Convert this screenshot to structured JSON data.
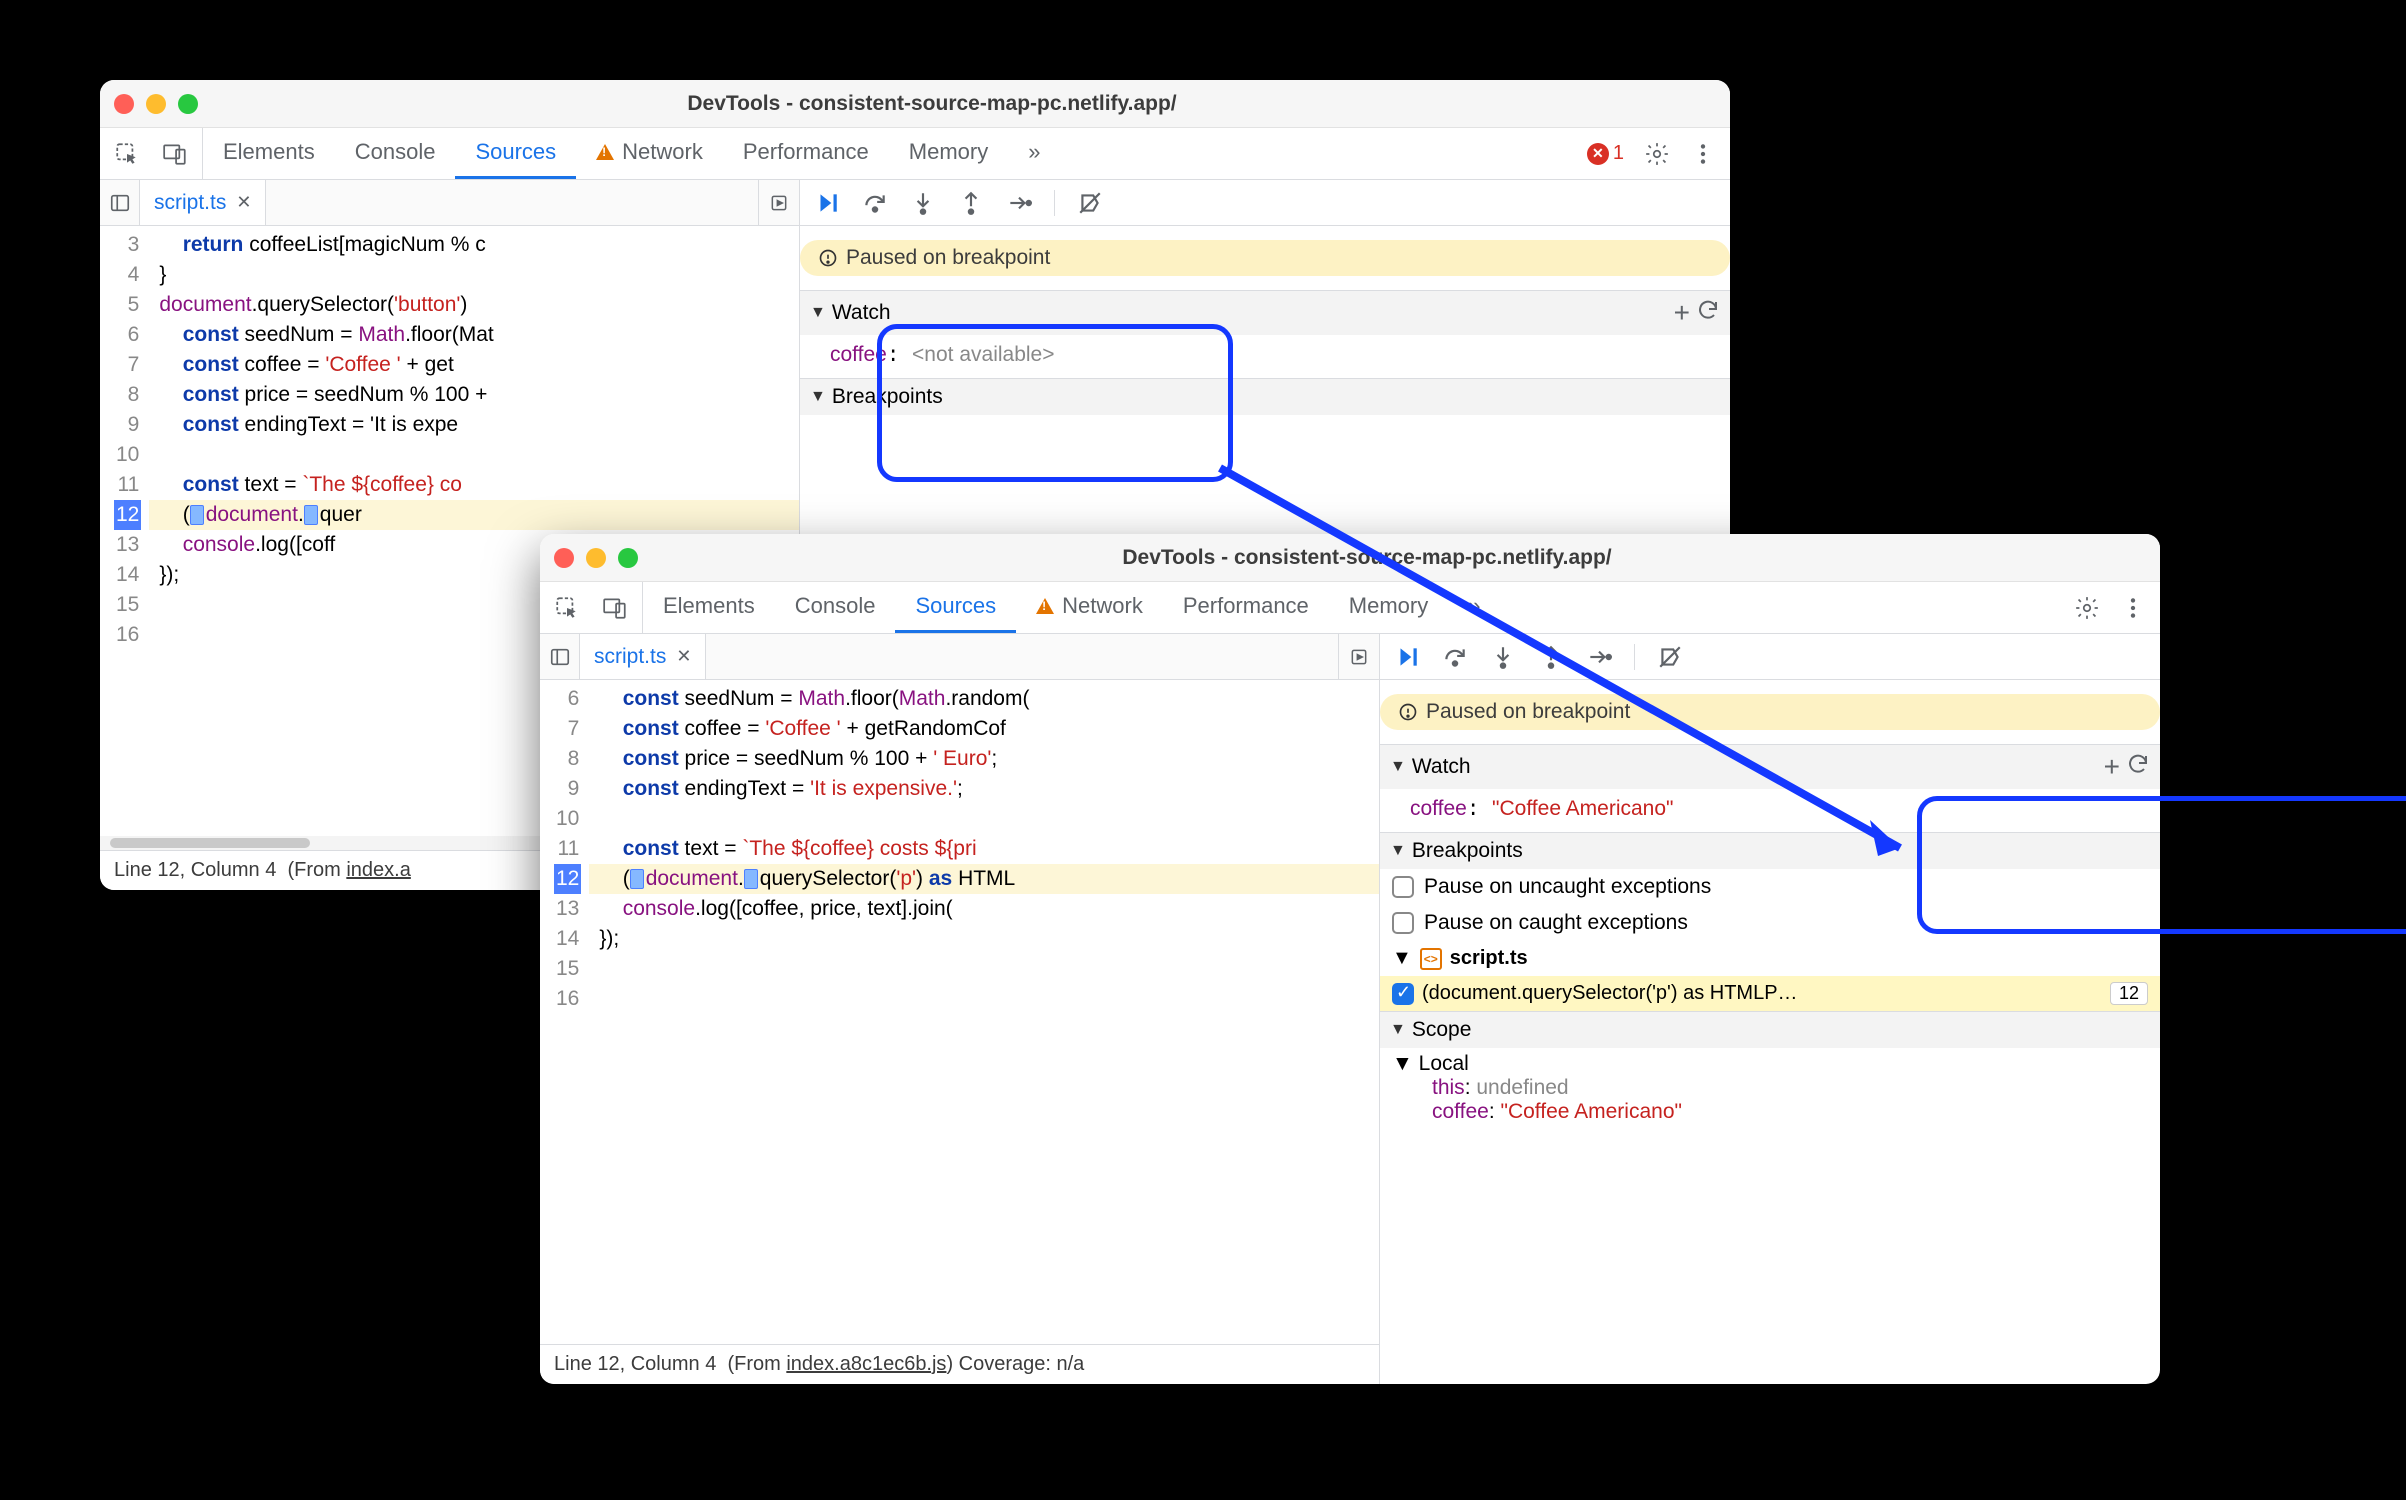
{
  "win1": {
    "title": "DevTools - consistent-source-map-pc.netlify.app/",
    "tabs": {
      "elements": "Elements",
      "console": "Console",
      "sources": "Sources",
      "network": "Network",
      "performance": "Performance",
      "memory": "Memory"
    },
    "error_count": "1",
    "file_tab": "script.ts",
    "gutter_start": 3,
    "code_lines": [
      "    return coffeeList[magicNum % c",
      "}",
      "document.querySelector('button')",
      "    const seedNum = Math.floor(Mat",
      "    const coffee = 'Coffee ' + get",
      "    const price = seedNum % 100 + ",
      "    const endingText = 'It is expe",
      "",
      "    const text = `The ${coffee} co",
      "    (▯document.▯quer",
      "    console.log([coff",
      "});",
      "",
      ""
    ],
    "exec_line_index": 9,
    "status": "Line 12, Column 4  (From index.a",
    "paused": "Paused on breakpoint",
    "watch_label": "Watch",
    "watch_key": "coffee",
    "watch_val": "<not available>",
    "breakpoints_label": "Breakpoints"
  },
  "win2": {
    "title": "DevTools - consistent-source-map-pc.netlify.app/",
    "tabs": {
      "elements": "Elements",
      "console": "Console",
      "sources": "Sources",
      "network": "Network",
      "performance": "Performance",
      "memory": "Memory"
    },
    "file_tab": "script.ts",
    "gutter_start": 6,
    "code_lines": [
      "    const seedNum = Math.floor(Math.random(",
      "    const coffee = 'Coffee ' + getRandomCof",
      "    const price = seedNum % 100 + ' Euro';",
      "    const endingText = 'It is expensive.';",
      "",
      "    const text = `The ${coffee} costs ${pri",
      "    (▯document.▯querySelector('p') as HTML",
      "    console.log([coffee, price, text].join(",
      "});",
      "",
      ""
    ],
    "exec_line_index": 6,
    "status_a": "Line 12, Column 4  (From ",
    "status_link": "index.a8c1ec6b.js",
    "status_b": ") Coverage: n/a",
    "paused": "Paused on breakpoint",
    "watch_label": "Watch",
    "watch_key": "coffee",
    "watch_val": "\"Coffee Americano\"",
    "breakpoints_label": "Breakpoints",
    "pause_uncaught": "Pause on uncaught exceptions",
    "pause_caught": "Pause on caught exceptions",
    "bp_file": "script.ts",
    "bp_text": "(document.querySelector('p') as HTMLP…",
    "bp_line": "12",
    "scope_label": "Scope",
    "scope_local": "Local",
    "scope_this_k": "this",
    "scope_this_v": "undefined",
    "scope_coffee_k": "coffee",
    "scope_coffee_v": "\"Coffee Americano\""
  }
}
